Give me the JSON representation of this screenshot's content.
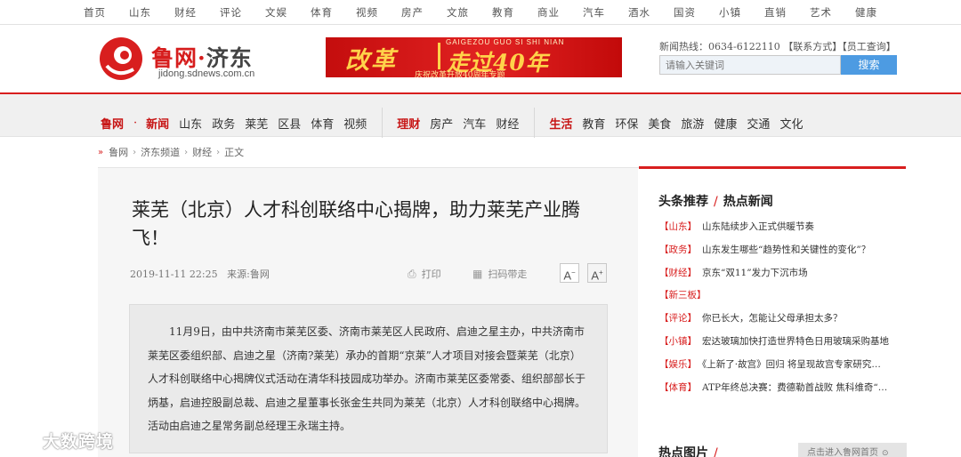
{
  "top_nav": [
    "首页",
    "山东",
    "财经",
    "评论",
    "文娱",
    "体育",
    "视频",
    "房产",
    "文旅",
    "教育",
    "商业",
    "汽车",
    "酒水",
    "国资",
    "小镇",
    "直销",
    "艺术",
    "健康"
  ],
  "header": {
    "logo_title_main": "鲁网",
    "logo_title_dot": "·",
    "logo_title_sub": "济东",
    "logo_url": "jidong.sdnews.com.cn",
    "banner_text_1": "改革",
    "banner_text_2": "走过40年",
    "banner_pinyin": "GAIGEZOU GUO SI SHI NIAN",
    "banner_small": "庆祝改革开放40周年专题",
    "hotline": "新闻热线：0634-6122110 【联系方式】【员工查询】",
    "search_placeholder": "请输入关键词",
    "search_button": "搜索"
  },
  "main_nav": {
    "group1": [
      "鲁网",
      "·",
      "新闻",
      "山东",
      "政务",
      "莱芜",
      "区县",
      "体育",
      "视频"
    ],
    "group2": [
      "理财",
      "房产",
      "汽车",
      "财经"
    ],
    "group3": [
      "生活",
      "教育",
      "环保",
      "美食",
      "旅游",
      "健康",
      "交通",
      "文化"
    ]
  },
  "breadcrumb": [
    "鲁网",
    "济东频道",
    "财经",
    "正文"
  ],
  "article": {
    "title": "莱芜（北京）人才科创联络中心揭牌，助力莱芜产业腾飞！",
    "date": "2019-11-11 22:25",
    "source": "来源:鲁网",
    "print": "打印",
    "qr": "扫码带走",
    "font_smaller": "A",
    "font_larger": "A",
    "body": "11月9日，由中共济南市莱芜区委、济南市莱芜区人民政府、启迪之星主办，中共济南市莱芜区委组织部、启迪之星（济南?莱芜）承办的首期“京莱”人才项目对接会暨莱芜（北京）人才科创联络中心揭牌仪式活动在清华科技园成功举办。济南市莱芜区委常委、组织部部长于炳基，启迪控股副总裁、启迪之星董事长张金生共同为莱芜（北京）人才科创联络中心揭牌。活动由启迪之星常务副总经理王永瑞主持。"
  },
  "sidebar": {
    "heading_a": "头条推荐",
    "heading_b": "热点新闻",
    "items": [
      {
        "tag": "【山东】",
        "text": "山东陆续步入正式供暖节奏"
      },
      {
        "tag": "【政务】",
        "text": "山东发生哪些“趋势性和关键性的变化”？"
      },
      {
        "tag": "【财经】",
        "text": "京东“双11”发力下沉市场"
      },
      {
        "tag": "【新三板】",
        "text": ""
      },
      {
        "tag": "【评论】",
        "text": "你已长大，怎能让父母承担太多？"
      },
      {
        "tag": "【小镇】",
        "text": "宏达玻璃加快打造世界特色日用玻璃采购基地"
      },
      {
        "tag": "【娱乐】",
        "text": "《上新了·故宫》回归 将呈现故宫专家研究…"
      },
      {
        "tag": "【体育】",
        "text": "ATP年终总决赛：费德勒首战败 焦科维奇“…"
      }
    ],
    "heading_pics": "热点图片",
    "more_button": "点击进入鲁网首页"
  },
  "watermark": "大数跨境",
  "colors": {
    "brand_red": "#d81e1e",
    "search_blue": "#4d9be2"
  }
}
